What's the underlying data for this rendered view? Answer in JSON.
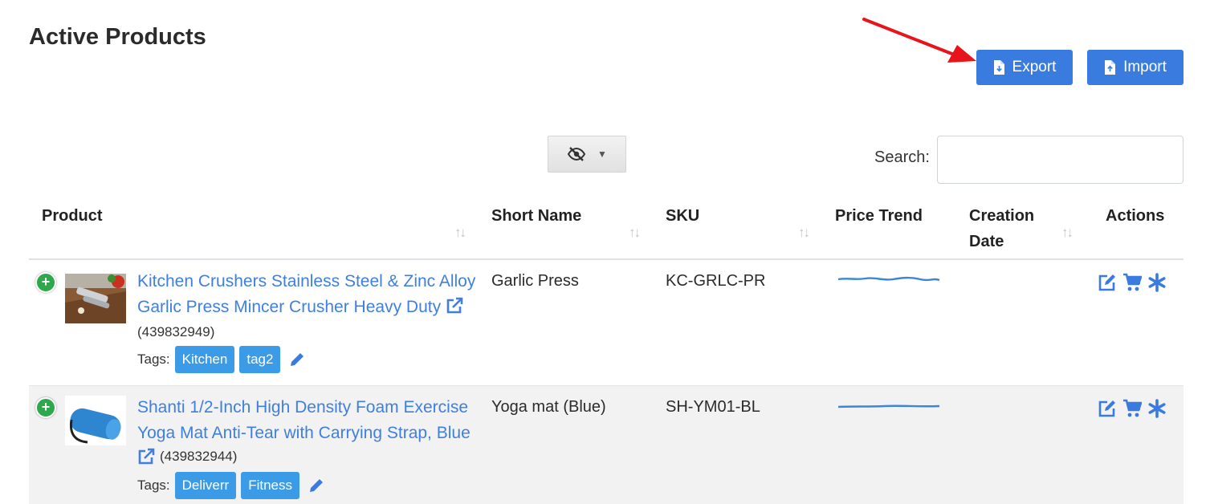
{
  "page": {
    "title": "Active Products"
  },
  "toolbar": {
    "export_label": "Export",
    "import_label": "Import"
  },
  "column_toggle": {
    "icon": "eye-slash-icon",
    "caret": "▼"
  },
  "search": {
    "label": "Search:",
    "value": "",
    "placeholder": ""
  },
  "table": {
    "columns": [
      {
        "key": "product",
        "label": "Product",
        "sortable": true
      },
      {
        "key": "short_name",
        "label": "Short Name",
        "sortable": true
      },
      {
        "key": "sku",
        "label": "SKU",
        "sortable": true
      },
      {
        "key": "price_trend",
        "label": "Price Trend",
        "sortable": false
      },
      {
        "key": "creation_date",
        "label": "Creation Date",
        "label_line1": "Creation",
        "label_line2": "Date",
        "sortable": true
      },
      {
        "key": "actions",
        "label": "Actions",
        "sortable": false
      }
    ],
    "sort_glyph": "↑↓",
    "tags_label": "Tags:",
    "rows": [
      {
        "title_line1": "Kitchen Crushers Stainless Steel & Zinc Alloy",
        "title_line2": "Garlic Press Mincer Crusher Heavy Duty",
        "asin": "(439832949)",
        "tags": [
          "Kitchen",
          "tag2"
        ],
        "short_name": "Garlic Press",
        "sku": "KC-GRLC-PR",
        "creation_date": ""
      },
      {
        "title_line1": "Shanti 1/2-Inch High Density Foam Exercise",
        "title_line2": "Yoga Mat Anti-Tear with Carrying Strap, Blue",
        "asin": "(439832944)",
        "tags": [
          "Deliverr",
          "Fitness"
        ],
        "short_name": "Yoga mat (Blue)",
        "sku": "SH-YM01-BL",
        "creation_date": ""
      }
    ]
  },
  "colors": {
    "primary": "#3a7be0",
    "link": "#3f7fe0",
    "tag": "#3c9be6",
    "expand": "#2ea84c",
    "annotation_arrow": "#e8141b"
  }
}
